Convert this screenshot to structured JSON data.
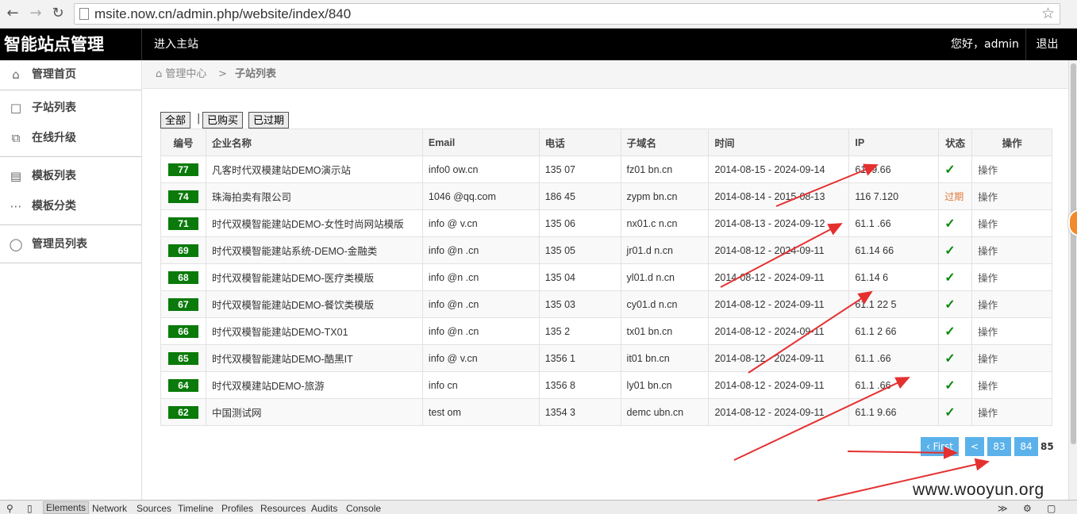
{
  "browser": {
    "url": "msite.now.cn/admin.php/website/index/840"
  },
  "header": {
    "brand": "智能站点管理",
    "enter_site": "进入主站",
    "greeting": "您好，admin",
    "logout": "退出"
  },
  "sidebar": {
    "items": [
      {
        "label": "管理首页",
        "icon": "home-icon"
      },
      {
        "label": "子站列表",
        "icon": "folder-icon"
      },
      {
        "label": "在线升级",
        "icon": "copy-icon"
      },
      {
        "label": "模板列表",
        "icon": "monitor-icon"
      },
      {
        "label": "模板分类",
        "icon": "sitemap-icon"
      },
      {
        "label": "管理员列表",
        "icon": "user-icon"
      }
    ]
  },
  "breadcrumb": {
    "home": "管理中心",
    "separator": ">",
    "current": "子站列表"
  },
  "filters": {
    "all": "全部",
    "separator": "|",
    "purchased": "已购买",
    "expired": "已过期"
  },
  "table": {
    "headers": [
      "编号",
      "企业名称",
      "Email",
      "电话",
      "子域名",
      "时间",
      "IP",
      "状态",
      "操作"
    ],
    "rows": [
      {
        "id": "77",
        "name": "凡客时代双模建站DEMO演示站",
        "email": "info0      ow.cn",
        "phone": "135        07",
        "subdomain": "fz01       bn.cn",
        "time": "2014-08-15 - 2024-09-14",
        "ip": "61.         9.66",
        "status": "ok",
        "op": "操作"
      },
      {
        "id": "74",
        "name": "珠海拍卖有限公司",
        "email": "1046          @qq.com",
        "phone": "186         45",
        "subdomain": "zypm       bn.cn",
        "time": "2014-08-14 - 2015-08-13",
        "ip": "116          7.120",
        "status": "过期",
        "op": "操作"
      },
      {
        "id": "71",
        "name": "时代双模智能建站DEMO-女性时尚网站模版",
        "email": "info      @     v.cn",
        "phone": "135         06",
        "subdomain": "nx01.c      n.cn",
        "time": "2014-08-13 - 2024-09-12",
        "ip": "61.1         .66",
        "status": "ok",
        "op": "操作"
      },
      {
        "id": "69",
        "name": "时代双模智能建站系统-DEMO-金融类",
        "email": "info      @n    .cn",
        "phone": "135         05",
        "subdomain": "jr01.d      n.cn",
        "time": "2014-08-12 - 2024-09-11",
        "ip": "61.14        66",
        "status": "ok",
        "op": "操作"
      },
      {
        "id": "68",
        "name": "时代双模智能建站DEMO-医疗类模版",
        "email": "info      @n    .cn",
        "phone": "135         04",
        "subdomain": "yl01.d      n.cn",
        "time": "2014-08-12 - 2024-09-11",
        "ip": "61.14        6",
        "status": "ok",
        "op": "操作"
      },
      {
        "id": "67",
        "name": "时代双模智能建站DEMO-餐饮类模版",
        "email": "info      @n    .cn",
        "phone": "135         03",
        "subdomain": "cy01.d      n.cn",
        "time": "2014-08-12 - 2024-09-11",
        "ip": "61.1      22    5",
        "status": "ok",
        "op": "操作"
      },
      {
        "id": "66",
        "name": "时代双模智能建站DEMO-TX01",
        "email": "info      @n    .cn",
        "phone": "135          2",
        "subdomain": "tx01       bn.cn",
        "time": "2014-08-12 - 2024-09-11",
        "ip": "61.1       2    66",
        "status": "ok",
        "op": "操作"
      },
      {
        "id": "65",
        "name": "时代双模智能建站DEMO-酷黑IT",
        "email": "info      @     v.cn",
        "phone": "1356          1",
        "subdomain": "it01       bn.cn",
        "time": "2014-08-12 - 2024-09-11",
        "ip": "61.1         .66",
        "status": "ok",
        "op": "操作"
      },
      {
        "id": "64",
        "name": "时代双模建站DEMO-旅游",
        "email": "info           cn",
        "phone": "1356          8",
        "subdomain": "ly01       bn.cn",
        "time": "2014-08-12 - 2024-09-11",
        "ip": "61.1         .66",
        "status": "ok",
        "op": "操作"
      },
      {
        "id": "62",
        "name": "中国测试网",
        "email": "test           om",
        "phone": "1354          3",
        "subdomain": "demc       ubn.cn",
        "time": "2014-08-12 - 2024-09-11",
        "ip": "61.1         9.66",
        "status": "ok",
        "op": "操作"
      }
    ]
  },
  "pagination": {
    "first": "‹ First",
    "prev": "<",
    "pages": [
      "83",
      "84"
    ],
    "current": "85"
  },
  "devtools": {
    "tabs": [
      "Elements",
      "Network",
      "Sources",
      "Timeline",
      "Profiles",
      "Resources",
      "Audits",
      "Console"
    ]
  },
  "watermark": "www.wooyun.org",
  "colors": {
    "badge_green": "#0a7a0a",
    "pager_blue": "#5bb2ea",
    "expired_orange": "#e0763a",
    "arrow_red": "#e53030"
  }
}
